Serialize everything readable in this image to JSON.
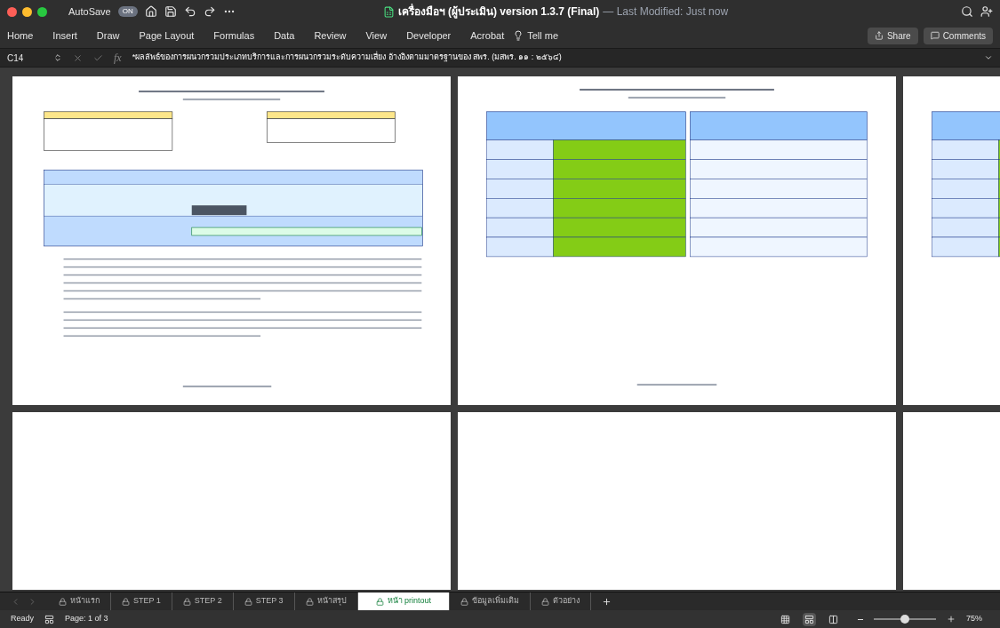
{
  "window": {
    "title": "เครื่องมือฯ (ผู้ประเมิน) version 1.3.7 (Final)",
    "subtitle": "— Last Modified: Just now",
    "autosave": {
      "label": "AutoSave",
      "state": "ON",
      "on": true
    }
  },
  "ribbon": {
    "tabs": [
      {
        "label": "Home",
        "selected": false
      },
      {
        "label": "Insert",
        "selected": false
      },
      {
        "label": "Draw",
        "selected": false
      },
      {
        "label": "Page Layout",
        "selected": false
      },
      {
        "label": "Formulas",
        "selected": false
      },
      {
        "label": "Data",
        "selected": false
      },
      {
        "label": "Review",
        "selected": false
      },
      {
        "label": "View",
        "selected": false
      },
      {
        "label": "Developer",
        "selected": false
      },
      {
        "label": "Acrobat",
        "selected": false
      }
    ],
    "tell_me": "Tell me",
    "share": "Share",
    "comments": "Comments"
  },
  "formula_bar": {
    "cell": "C14",
    "fx": "fx",
    "value": "*ผลลัพธ์ของการผนวกรวมประเภทบริการและการผนวกรวมระดับความเสี่ยง อ้างอิงตามมาตรฐานของ สพร. (มสพร. ๑๑ : ๒๕๖๔)"
  },
  "sheet_tabs": [
    {
      "label": "หน้าแรก",
      "locked": true,
      "selected": false
    },
    {
      "label": "STEP 1",
      "locked": true,
      "selected": false
    },
    {
      "label": "STEP 2",
      "locked": true,
      "selected": false
    },
    {
      "label": "STEP 3",
      "locked": true,
      "selected": false
    },
    {
      "label": "หน้าสรุป",
      "locked": true,
      "selected": false
    },
    {
      "label": "หน้า printout",
      "locked": true,
      "selected": true
    },
    {
      "label": "ข้อมูลเพิ่มเติม",
      "locked": true,
      "selected": false
    },
    {
      "label": "ตัวอย่าง",
      "locked": true,
      "selected": false
    }
  ],
  "status_bar": {
    "status": "Ready",
    "page": "Page: 1 of 3",
    "views": [
      {
        "kind": "normal",
        "selected": false
      },
      {
        "kind": "page_layout",
        "selected": true
      },
      {
        "kind": "page_break",
        "selected": false
      }
    ],
    "zoom": {
      "level": 0.5,
      "reading": "75%"
    }
  },
  "pages": [
    {
      "kind": "summary"
    },
    {
      "kind": "matrix"
    },
    {
      "kind": "matrix"
    },
    {
      "kind": "blank"
    },
    {
      "kind": "blank"
    },
    {
      "kind": "blank"
    }
  ]
}
